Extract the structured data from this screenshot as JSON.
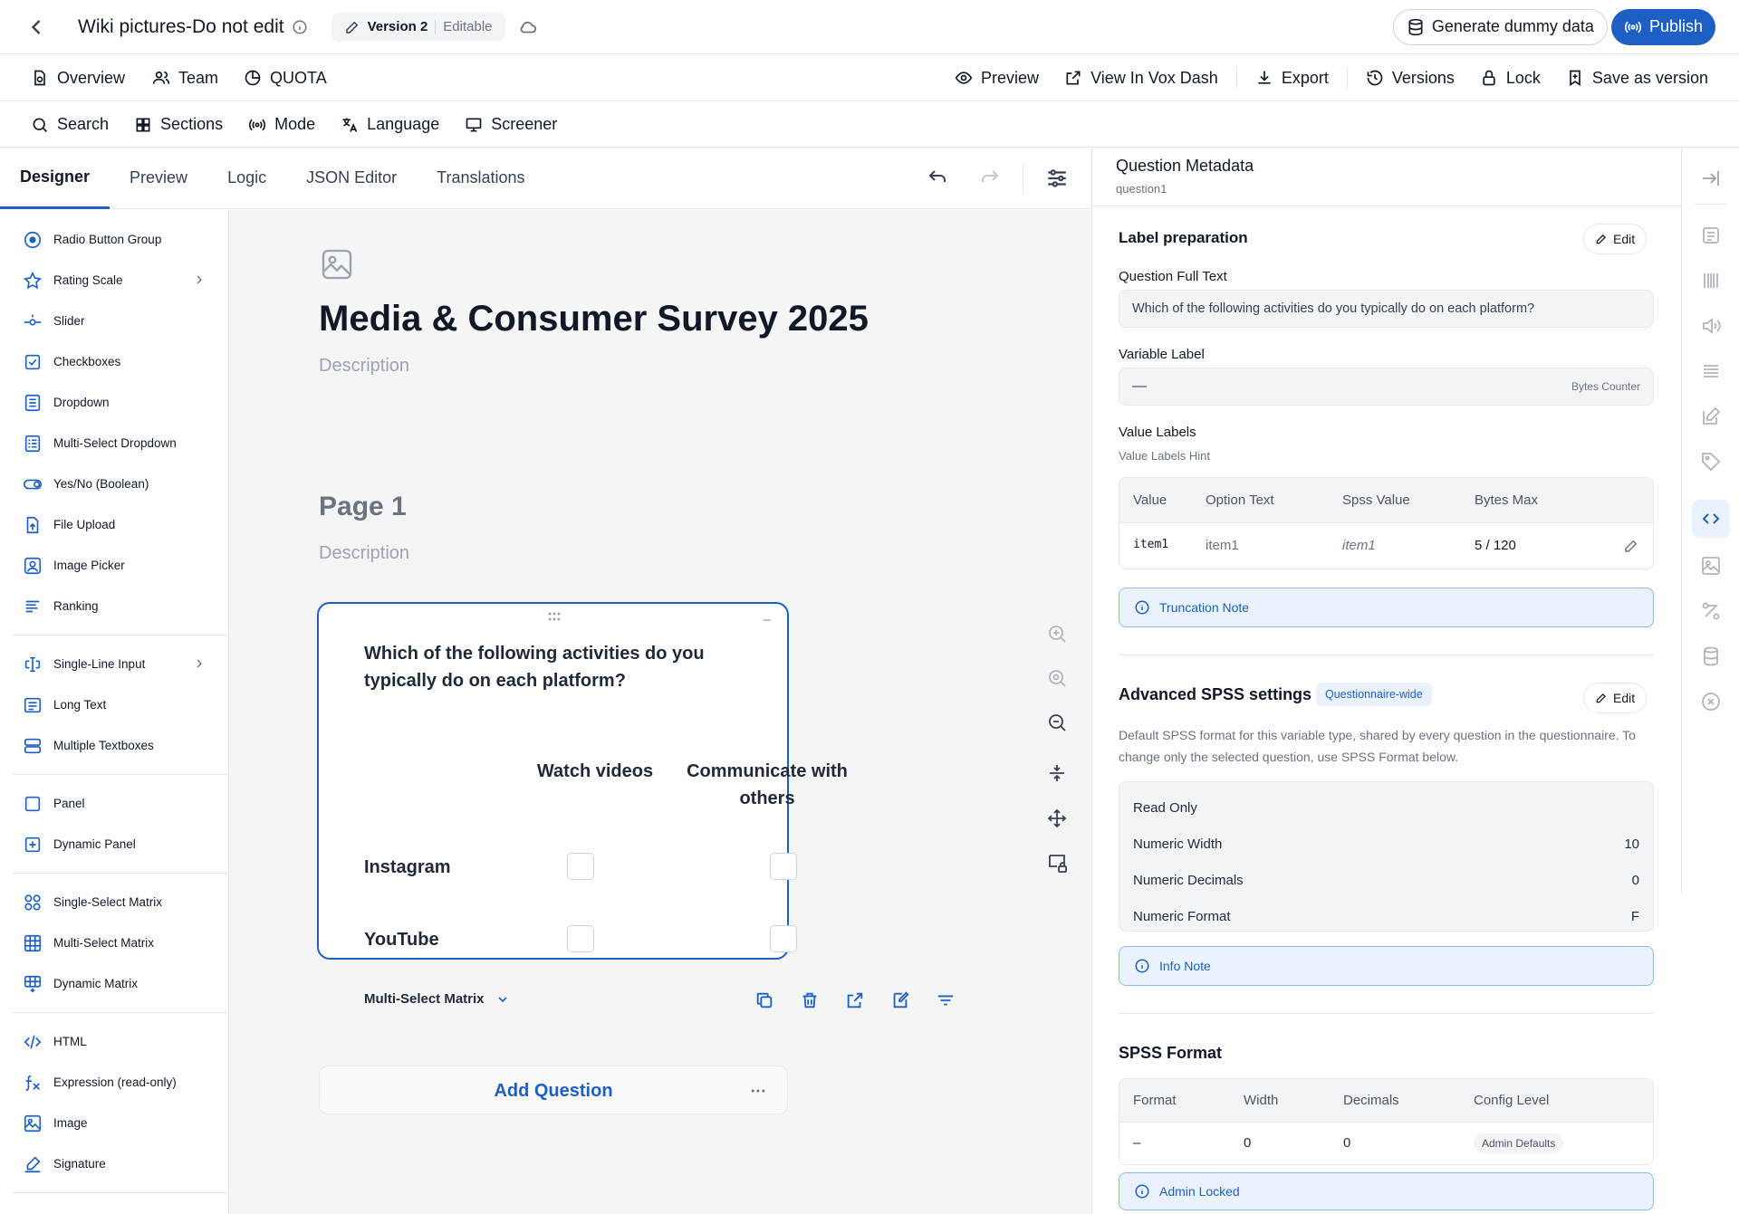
{
  "topbar": {
    "title": "Wiki pictures-Do not edit",
    "version": "Version 2",
    "version_status": "Editable",
    "generate_label": "Generate dummy data",
    "publish_label": "Publish"
  },
  "nav": {
    "overview": "Overview",
    "team": "Team",
    "quota": "QUOTA",
    "preview": "Preview",
    "view_vox": "View In Vox Dash",
    "export": "Export",
    "versions": "Versions",
    "lock": "Lock",
    "save_version": "Save as version"
  },
  "toolbar": {
    "search": "Search",
    "sections": "Sections",
    "mode": "Mode",
    "language": "Language",
    "screener": "Screener"
  },
  "tabs": [
    "Designer",
    "Preview",
    "Logic",
    "JSON Editor",
    "Translations"
  ],
  "palette": {
    "radio": "Radio Button Group",
    "rating": "Rating Scale",
    "slider": "Slider",
    "checkboxes": "Checkboxes",
    "dropdown": "Dropdown",
    "multidropdown": "Multi-Select Dropdown",
    "yesno": "Yes/No (Boolean)",
    "fileupload": "File Upload",
    "imagepicker": "Image Picker",
    "ranking": "Ranking",
    "singleline": "Single-Line Input",
    "longtext": "Long Text",
    "multitext": "Multiple Textboxes",
    "panel": "Panel",
    "dynpanel": "Dynamic Panel",
    "singlematrix": "Single-Select Matrix",
    "multimatrix": "Multi-Select Matrix",
    "dynmatrix": "Dynamic Matrix",
    "html": "HTML",
    "expression": "Expression (read-only)",
    "image": "Image",
    "signature": "Signature"
  },
  "survey": {
    "title": "Media & Consumer Survey 2025",
    "description": "Description",
    "page_title": "Page 1",
    "page_description": "Description",
    "question": "Which of the following activities do you typically do on each platform?",
    "columns": [
      "Watch videos",
      "Communicate with others"
    ],
    "rows": [
      "Instagram",
      "YouTube"
    ],
    "type_label": "Multi-Select Matrix",
    "add_question": "Add Question"
  },
  "meta": {
    "title": "Question Metadata",
    "subtitle": "question1",
    "label_prep": "Label preparation",
    "edit": "Edit",
    "full_text_label": "Question Full Text",
    "full_text": "Which of the following activities do you typically do on each platform?",
    "var_label": "Variable Label",
    "var_value": "—",
    "bytes_counter": "Bytes Counter",
    "value_labels": "Value Labels",
    "value_labels_hint": "Value Labels Hint",
    "vl_headers": [
      "Value",
      "Option Text",
      "Spss Value",
      "Bytes Max"
    ],
    "vl_row": {
      "value": "item1",
      "option": "item1",
      "spss": "item1",
      "bytes": "5 / 120"
    },
    "truncation": "Truncation Note",
    "adv_title": "Advanced SPSS settings",
    "adv_badge": "Questionnaire-wide",
    "adv_desc": "Default SPSS format for this variable type, shared by every question in the questionnaire. To change only the selected question, use SPSS Format below.",
    "adv_rows": [
      {
        "k": "Read Only",
        "v": ""
      },
      {
        "k": "Numeric Width",
        "v": "10"
      },
      {
        "k": "Numeric Decimals",
        "v": "0"
      },
      {
        "k": "Numeric Format",
        "v": "F"
      }
    ],
    "info_note": "Info Note",
    "spss_title": "SPSS Format",
    "spss_headers": [
      "Format",
      "Width",
      "Decimals",
      "Config Level"
    ],
    "spss_row": {
      "format": "–",
      "width": "0",
      "decimals": "0",
      "level": "Admin Defaults"
    },
    "admin_locked": "Admin Locked"
  },
  "colors": {
    "accent": "#1d5fc4",
    "border": "#e5e7eb",
    "canvas": "#f5f5f6"
  }
}
